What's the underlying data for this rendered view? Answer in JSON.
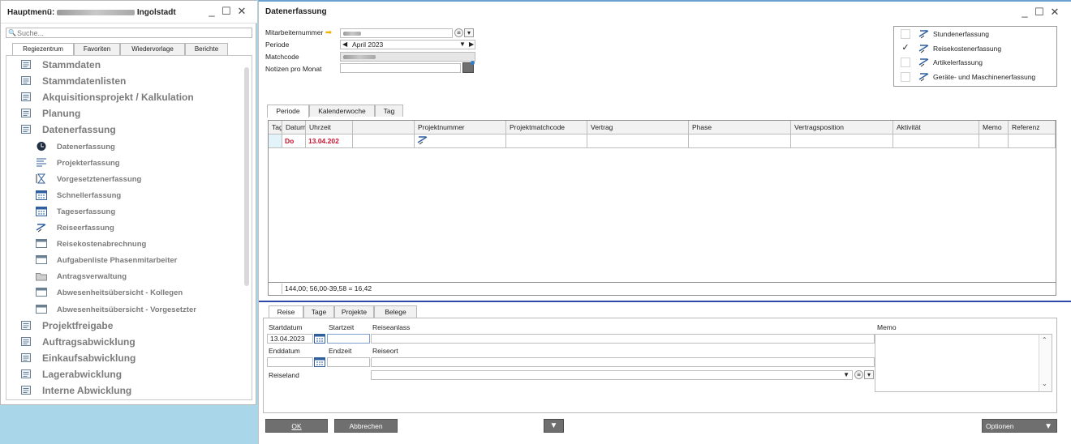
{
  "main_menu": {
    "title_prefix": "Hauptmenü:",
    "title_location": "Ingolstadt",
    "search_placeholder": "Suche...",
    "tabs": [
      "Regiezentrum",
      "Favoriten",
      "Wiedervorlage",
      "Berichte"
    ],
    "active_tab": "Regiezentrum",
    "items": [
      {
        "label": "Stammdaten",
        "level": "top",
        "icon": "table-icon"
      },
      {
        "label": "Stammdatenlisten",
        "level": "top",
        "icon": "list-icon"
      },
      {
        "label": "Akquisitionsprojekt / Kalkulation",
        "level": "top",
        "icon": "calculator-icon"
      },
      {
        "label": "Planung",
        "level": "top",
        "icon": "planning-icon"
      },
      {
        "label": "Datenerfassung",
        "level": "top",
        "icon": "data-entry-icon"
      },
      {
        "label": "Datenerfassung",
        "level": "sub",
        "icon": "clock-icon"
      },
      {
        "label": "Projekterfassung",
        "level": "sub",
        "icon": "project-icon"
      },
      {
        "label": "Vorgesetztenerfassung",
        "level": "sub",
        "icon": "hourglass-icon"
      },
      {
        "label": "Schnellerfassung",
        "level": "sub",
        "icon": "calendar-icon"
      },
      {
        "label": "Tageserfassung",
        "level": "sub",
        "icon": "calendar-icon"
      },
      {
        "label": "Reiseerfassung",
        "level": "sub",
        "icon": "travel-icon"
      },
      {
        "label": "Reisekostenabrechnung",
        "level": "sub",
        "icon": "window-icon"
      },
      {
        "label": "Aufgabenliste Phasenmitarbeiter",
        "level": "sub",
        "icon": "window-icon"
      },
      {
        "label": "Antragsverwaltung",
        "level": "sub",
        "icon": "folder-icon"
      },
      {
        "label": "Abwesenheitsübersicht - Kollegen",
        "level": "sub",
        "icon": "window-icon"
      },
      {
        "label": "Abwesenheitsübersicht - Vorgesetzter",
        "level": "sub",
        "icon": "window-icon"
      },
      {
        "label": "Projektfreigabe",
        "level": "top",
        "icon": "approve-icon"
      },
      {
        "label": "Auftragsabwicklung",
        "level": "top",
        "icon": "cycle-icon"
      },
      {
        "label": "Einkaufsabwicklung",
        "level": "top",
        "icon": "cart-icon"
      },
      {
        "label": "Lagerabwicklung",
        "level": "top",
        "icon": "warehouse-icon"
      },
      {
        "label": "Interne Abwicklung",
        "level": "top",
        "icon": "building-icon"
      }
    ]
  },
  "data_entry": {
    "title": "Datenerfassung",
    "fields": {
      "employee_number_label": "Mitarbeiternummer",
      "period_label": "Periode",
      "period_value": "April 2023",
      "matchcode_label": "Matchcode",
      "notes_label": "Notizen pro Monat"
    },
    "categories": [
      {
        "label": "Stundenerfassung",
        "checked": false,
        "icon": "hours-icon"
      },
      {
        "label": "Reisekostenerfassung",
        "checked": true,
        "icon": "travel-cost-icon"
      },
      {
        "label": "Artikelerfassung",
        "checked": false,
        "icon": "article-icon"
      },
      {
        "label": "Geräte- und Maschinenerfassung",
        "checked": false,
        "icon": "machine-icon"
      }
    ],
    "check_mark": "✓",
    "view_tabs": [
      "Periode",
      "Kalenderwoche",
      "Tag"
    ],
    "active_view_tab": "Periode",
    "grid": {
      "columns": [
        "Tag",
        "Datum",
        "Uhrzeit",
        "",
        "Projektnummer",
        "Projektmatchcode",
        "Vertrag",
        "Phase",
        "Vertragsposition",
        "Aktivität",
        "Memo",
        "Referenz"
      ],
      "row": {
        "tag": "Do",
        "datum": "13.04.202"
      },
      "footer_sum": "144,00;  56,00-39,58 = 16,42"
    },
    "bottom_tabs": [
      "Reise",
      "Tage",
      "Projekte",
      "Belege"
    ],
    "active_bottom_tab": "Reise",
    "reise": {
      "startdatum_label": "Startdatum",
      "startdatum_value": "13.04.2023",
      "startzeit_label": "Startzeit",
      "reiseanlass_label": "Reiseanlass",
      "enddatum_label": "Enddatum",
      "endzeit_label": "Endzeit",
      "reiseort_label": "Reiseort",
      "reiseland_label": "Reiseland",
      "memo_label": "Memo"
    },
    "buttons": {
      "ok": "OK",
      "cancel": "Abbrechen",
      "options": "Optionen"
    }
  }
}
